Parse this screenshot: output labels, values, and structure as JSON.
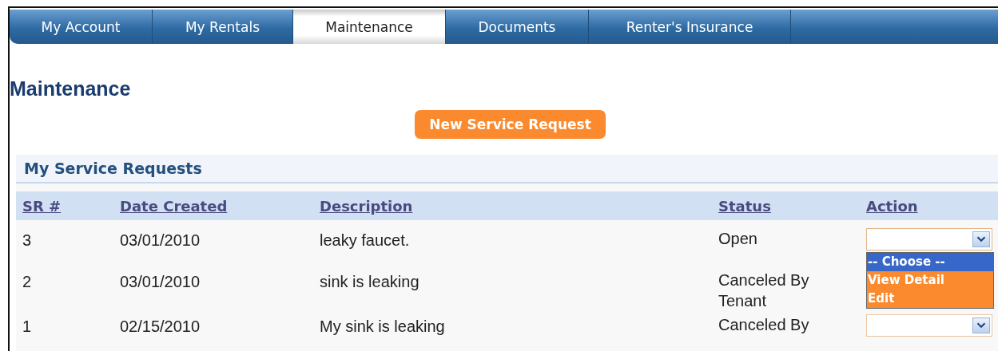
{
  "tabs": [
    {
      "label": "My Account",
      "selected": false
    },
    {
      "label": "My Rentals",
      "selected": false
    },
    {
      "label": "Maintenance",
      "selected": true
    },
    {
      "label": "Documents",
      "selected": false
    },
    {
      "label": "Renter's Insurance",
      "selected": false
    }
  ],
  "page_title": "Maintenance",
  "new_request_button": "New Service Request",
  "section_title": "My Service Requests",
  "table": {
    "columns": [
      "SR #",
      "Date Created",
      "Description",
      "Status",
      "Action"
    ],
    "rows": [
      {
        "sr": "3",
        "date": "03/01/2010",
        "description": "leaky faucet.",
        "status": "Open",
        "action": {
          "expanded": true,
          "options": [
            {
              "label": "-- Choose --",
              "selected": true
            },
            {
              "label": "View Detail",
              "selected": false
            },
            {
              "label": "Edit",
              "selected": false
            }
          ]
        }
      },
      {
        "sr": "2",
        "date": "03/01/2010",
        "description": "sink is leaking",
        "status": "Canceled By Tenant"
      },
      {
        "sr": "1",
        "date": "02/15/2010",
        "description": "My sink is leaking",
        "status": "Canceled By",
        "action": {
          "expanded": false
        }
      }
    ]
  }
}
